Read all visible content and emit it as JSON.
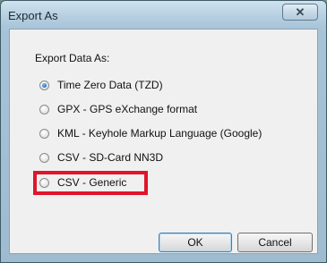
{
  "dialog": {
    "title": "Export As",
    "close_glyph": "✕"
  },
  "group_label": "Export Data As:",
  "options": [
    {
      "label": "Time Zero Data (TZD)",
      "checked": true
    },
    {
      "label": "GPX - GPS eXchange format",
      "checked": false
    },
    {
      "label": "KML - Keyhole Markup Language (Google)",
      "checked": false
    },
    {
      "label": "CSV - SD-Card NN3D",
      "checked": false
    },
    {
      "label": "CSV - Generic",
      "checked": false
    }
  ],
  "buttons": {
    "ok": "OK",
    "cancel": "Cancel"
  },
  "colors": {
    "highlight": "#e0152a"
  }
}
